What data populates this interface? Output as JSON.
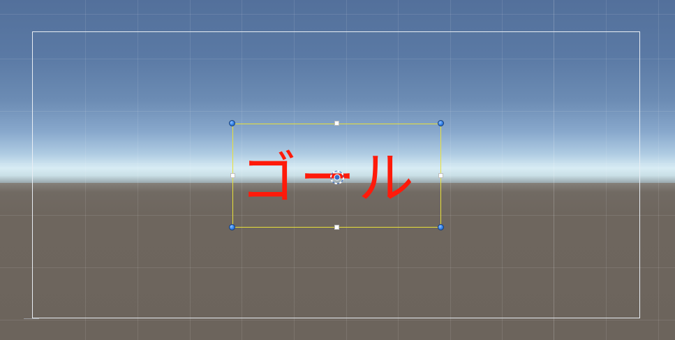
{
  "scene_view": {
    "selected_object": {
      "text": "ゴール",
      "text_color": "#ff1a0a"
    },
    "colors": {
      "rect_outline": "#e8e03a",
      "canvas_frame": "#e9eef4",
      "handle_blue": "#2f7ee6",
      "sky_top": "#53709b",
      "horizon": "#d8ecf4",
      "ground": "#6e665e"
    },
    "icons": {
      "pivot": "pivot-icon",
      "corner_handle": "corner-handle-icon",
      "edge_handle": "edge-handle-icon"
    }
  }
}
